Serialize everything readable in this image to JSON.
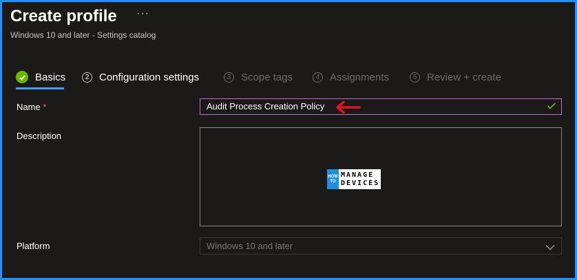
{
  "header": {
    "title": "Create profile",
    "more": "···",
    "subtitle": "Windows 10 and later - Settings catalog"
  },
  "tabs": [
    {
      "label": "Basics",
      "number": "",
      "state": "completed"
    },
    {
      "label": "Configuration settings",
      "number": "2",
      "state": "enabled"
    },
    {
      "label": "Scope tags",
      "number": "3",
      "state": "disabled"
    },
    {
      "label": "Assignments",
      "number": "4",
      "state": "disabled"
    },
    {
      "label": "Review + create",
      "number": "5",
      "state": "disabled"
    }
  ],
  "form": {
    "name_label": "Name",
    "required_mark": "*",
    "name_value": "Audit Process Creation Policy",
    "description_label": "Description",
    "description_value": "",
    "platform_label": "Platform",
    "platform_value": "Windows 10 and later"
  },
  "watermark": {
    "left_top": "HOW",
    "left_bottom": "TO",
    "right_top": "MANAGE",
    "right_bottom": "DEVICES"
  },
  "colors": {
    "accent": "#4f9cf6",
    "success": "#6bb700",
    "required": "#f1707b",
    "focus_border": "#c46ad8",
    "annotation_arrow": "#e81123",
    "frame_border": "#1e90ff"
  },
  "icons": {
    "more": "more-icon",
    "completed": "check-circle-icon",
    "valid": "checkmark-icon",
    "dropdown": "chevron-down-icon",
    "annotation": "arrow-left-icon"
  }
}
